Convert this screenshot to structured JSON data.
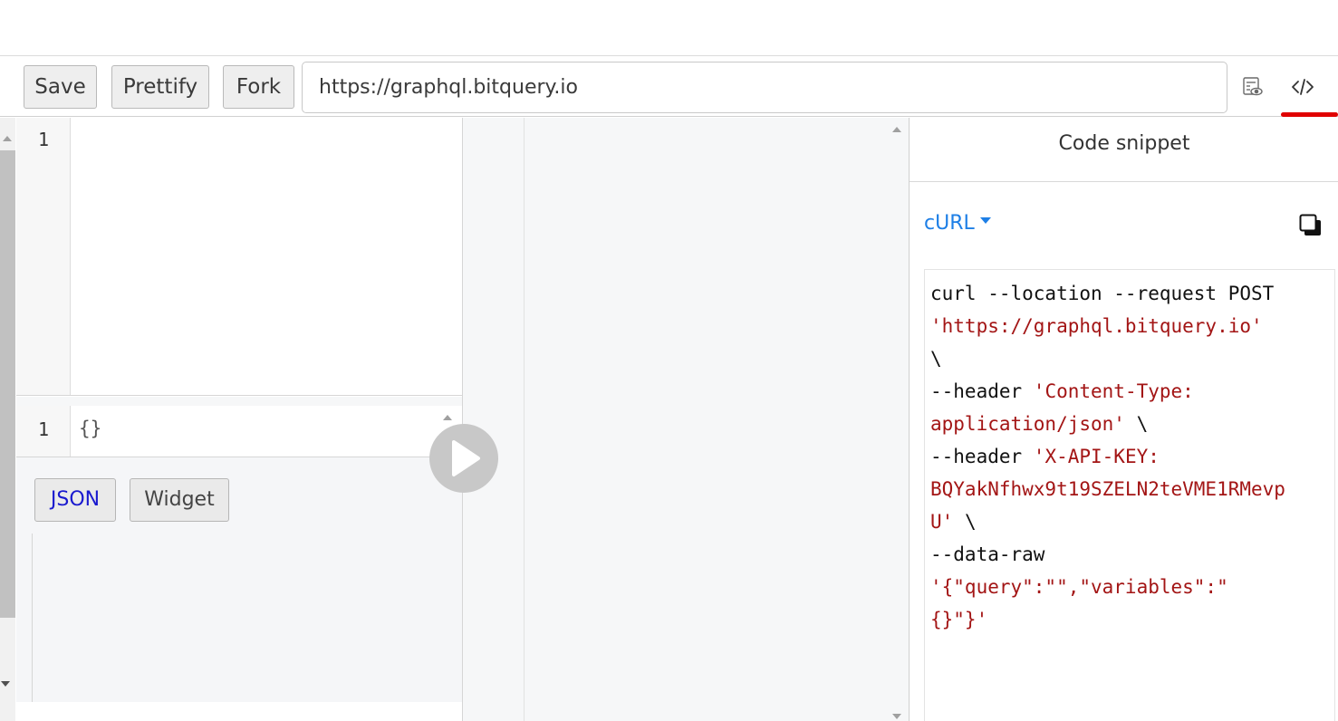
{
  "toolbar": {
    "save_label": "Save",
    "prettify_label": "Prettify",
    "fork_label": "Fork",
    "url_value": "https://graphql.bitquery.io",
    "icons": [
      "history-preview-icon",
      "code-icon"
    ]
  },
  "query_editor": {
    "line_numbers": [
      "1"
    ],
    "content": ""
  },
  "variables_editor": {
    "line_numbers": [
      "1"
    ],
    "content": "{}"
  },
  "bottom_tabs": {
    "json_label": "JSON",
    "widget_label": "Widget"
  },
  "run_button": {
    "icon": "play-icon"
  },
  "snippet": {
    "title": "Code snippet",
    "language": "cURL",
    "copy_icon": "copy-icon",
    "lines": [
      [
        {
          "t": "curl --location --request POST",
          "k": "plain"
        }
      ],
      [
        {
          "t": "'https://graphql.bitquery.io'",
          "k": "str"
        }
      ],
      [
        {
          "t": "\\",
          "k": "plain"
        }
      ],
      [
        {
          "t": "--header ",
          "k": "plain"
        },
        {
          "t": "'Content-Type:",
          "k": "str"
        }
      ],
      [
        {
          "t": "application/json'",
          "k": "str"
        },
        {
          "t": " \\",
          "k": "plain"
        }
      ],
      [
        {
          "t": "--header ",
          "k": "plain"
        },
        {
          "t": "'X-API-KEY:",
          "k": "str"
        }
      ],
      [
        {
          "t": "BQYakNfhwx9t19SZELN2teVME1RMevp",
          "k": "str"
        }
      ],
      [
        {
          "t": "U'",
          "k": "str"
        },
        {
          "t": " \\",
          "k": "plain"
        }
      ],
      [
        {
          "t": "--data-raw",
          "k": "plain"
        }
      ],
      [
        {
          "t": "'{\"query\":\"\",\"variables\":\"",
          "k": "str"
        }
      ],
      [
        {
          "t": "{}\"}'",
          "k": "str"
        }
      ]
    ]
  },
  "colors": {
    "accent_blue": "#1e7fe6",
    "string_red": "#a31515",
    "highlight_red": "#e00000"
  }
}
